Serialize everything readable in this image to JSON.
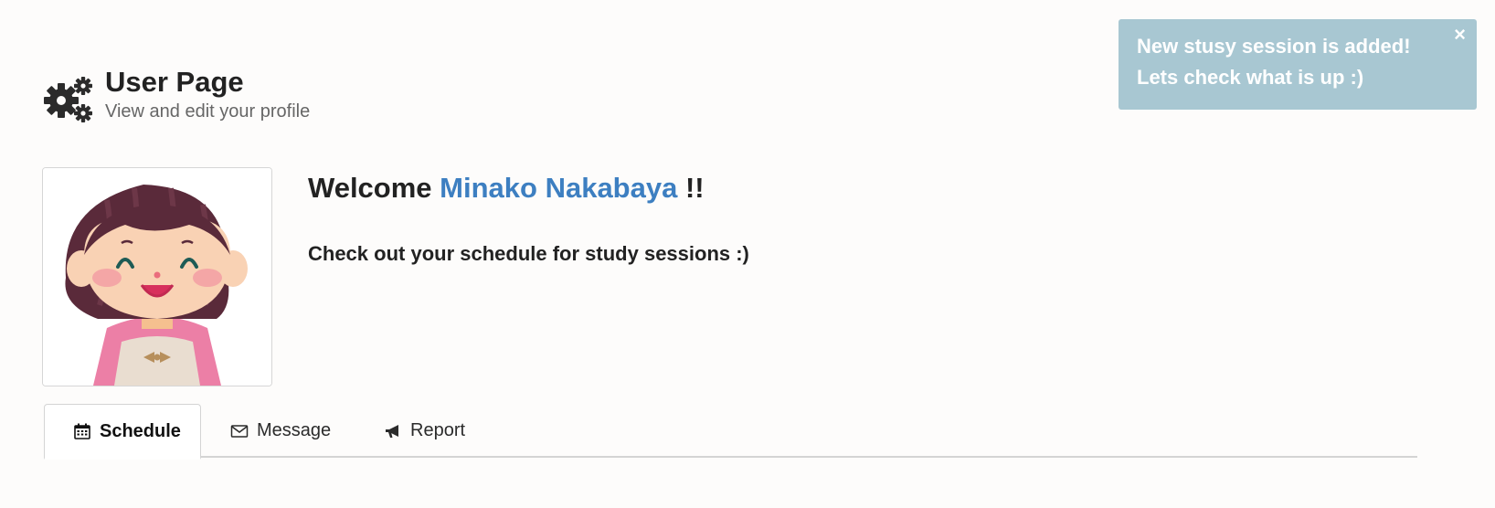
{
  "header": {
    "title": "User Page",
    "subtitle": "View and edit your profile",
    "icon": "gears-icon"
  },
  "toast": {
    "line1": "New stusy session is added!",
    "line2": "Lets check what is up :)",
    "close_label": "×",
    "color": "#a8c7d2"
  },
  "welcome": {
    "prefix": "Welcome",
    "user_name": "Minako Nakabaya",
    "suffix": "!!",
    "hint": "Check out your schedule for study sessions :)",
    "name_color": "#3d7fc1"
  },
  "tabs": [
    {
      "label": "Schedule",
      "icon": "calendar-icon",
      "active": true
    },
    {
      "label": "Message",
      "icon": "envelope-icon",
      "active": false
    },
    {
      "label": "Report",
      "icon": "bullhorn-icon",
      "active": false
    }
  ]
}
